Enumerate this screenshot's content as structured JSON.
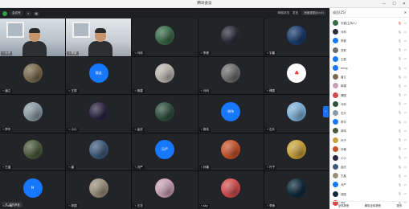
{
  "window": {
    "title": "腾讯会议",
    "controls": [
      "—",
      "☐",
      "✕"
    ]
  },
  "topbar": {
    "meeting_label": "会议号",
    "buttons": [
      "⏸",
      "▦"
    ],
    "right_items": [
      "网络状况",
      "发言",
      "视图布局"
    ],
    "layout_label": "宫格视图(5×5)"
  },
  "tiles": [
    {
      "name": "大东",
      "video": "vid1"
    },
    {
      "name": "李家",
      "video": "vid2"
    },
    {
      "name": "马科",
      "avatar_color": "#3a6b4a",
      "photo": true
    },
    {
      "name": "李健",
      "avatar_color": "#2a2d3a",
      "photo": true
    },
    {
      "name": "宇晨",
      "avatar_color": "#1a3d6e",
      "photo": true
    },
    {
      "name": "潘立",
      "avatar_color": "#7a6a4e",
      "photo": true
    },
    {
      "name": "王振",
      "avatar_color": "#1677ff",
      "avatar_text": "振友"
    },
    {
      "name": "蒋建",
      "avatar_color": "#b9b6ae",
      "photo": true
    },
    {
      "name": "马科",
      "avatar_color": "#6e6e6e",
      "photo": true
    },
    {
      "name": "傅国",
      "avatar_color": "#ffffff",
      "avatar_text": "♣"
    },
    {
      "name": "李华",
      "avatar_color": "#8a9aa4",
      "photo": true
    },
    {
      "name": "小小",
      "avatar_color": "#2b2440",
      "photo": true
    },
    {
      "name": "孟庆",
      "avatar_color": "#2f4f3f",
      "photo": true
    },
    {
      "name": "胡伟",
      "avatar_color": "#1677ff",
      "avatar_text": "胡伟"
    },
    {
      "name": "石头",
      "avatar_color": "#7fb1d8",
      "photo": true
    },
    {
      "name": "王晶",
      "avatar_color": "#4a5a3a",
      "photo": true
    },
    {
      "name": "潘",
      "avatar_color": "#3e5a7a",
      "photo": true
    },
    {
      "name": "冯严",
      "avatar_color": "#1677ff",
      "avatar_text": "冯严"
    },
    {
      "name": "孙楠",
      "avatar_color": "#c7532a",
      "photo": true
    },
    {
      "name": "叶子",
      "avatar_color": "#c9a23a",
      "photo": true
    },
    {
      "name": "ming",
      "avatar_color": "#1677ff",
      "avatar_text": "M"
    },
    {
      "name": "钱国",
      "avatar_color": "#9a8e7a",
      "photo": true
    },
    {
      "name": "王花",
      "avatar_color": "#c8a0b4",
      "photo": true
    },
    {
      "name": "sky",
      "avatar_color": "#d44d4d",
      "photo": true
    },
    {
      "name": "李雨",
      "avatar_color": "#0d2b3a",
      "photo": true
    }
  ],
  "side_panel": {
    "title": "成员(25)",
    "members": [
      {
        "name": "宇晨(主持人)",
        "color": "#3a6b4a",
        "mic": "on"
      },
      {
        "name": "马科",
        "color": "#2a2d3a",
        "mic": "off"
      },
      {
        "name": "李健",
        "color": "#1677ff",
        "mic": "off"
      },
      {
        "name": "苏莉",
        "color": "#6e6e6e",
        "mic": "off"
      },
      {
        "name": "王振",
        "color": "#1677ff",
        "mic": "off"
      },
      {
        "name": "ming",
        "color": "#1677ff",
        "mic": "off"
      },
      {
        "name": "潘立",
        "color": "#7a6a4e",
        "mic": "off"
      },
      {
        "name": "蒋建",
        "color": "#c8a0b4",
        "mic": "off"
      },
      {
        "name": "傅国",
        "color": "#d44d4d",
        "mic": "off"
      },
      {
        "name": "马科",
        "color": "#2f4f3f",
        "mic": "off"
      },
      {
        "name": "石头",
        "color": "#8a9aa4",
        "mic": "off"
      },
      {
        "name": "李华",
        "color": "#1677ff",
        "mic": "off"
      },
      {
        "name": "胡伟",
        "color": "#4a5a3a",
        "mic": "off"
      },
      {
        "name": "叶子",
        "color": "#c9a23a",
        "mic": "off"
      },
      {
        "name": "孙楠",
        "color": "#c7532a",
        "mic": "off"
      },
      {
        "name": "小小",
        "color": "#2b2440",
        "mic": "off"
      },
      {
        "name": "孟庆",
        "color": "#3e5a7a",
        "mic": "off"
      },
      {
        "name": "王晶",
        "color": "#9a8e7a",
        "mic": "off"
      },
      {
        "name": "冯严",
        "color": "#1677ff",
        "mic": "off"
      },
      {
        "name": "钱国",
        "color": "#0d2b3a",
        "mic": "off"
      },
      {
        "name": "sky",
        "color": "#d44d4d",
        "mic": "off"
      }
    ],
    "footer": [
      "全体静音",
      "解除全体静音",
      "更多"
    ]
  },
  "mini_bar": {
    "label": "我的声音"
  }
}
